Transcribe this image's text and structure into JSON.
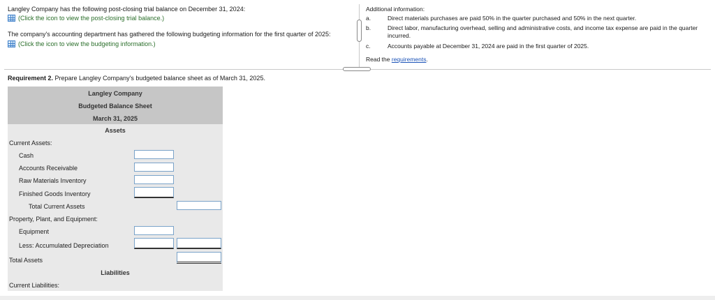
{
  "intro": {
    "trial_balance_text": "Langley Company has the following post-closing trial balance on December 31, 2024:",
    "trial_balance_link": "(Click the icon to view the post-closing trial balance.)",
    "budgeting_text": "The company's accounting department has gathered the following budgeting information for the first quarter of 2025:",
    "budgeting_link": "(Click the icon to view the budgeting information.)"
  },
  "additional": {
    "heading": "Additional information:",
    "items": [
      {
        "letter": "a.",
        "text": "Direct materials purchases are paid 50% in the quarter purchased and 50% in the next quarter."
      },
      {
        "letter": "b.",
        "text": "Direct labor, manufacturing overhead, selling and administrative costs, and income tax expense are paid in the quarter incurred."
      },
      {
        "letter": "c.",
        "text": "Accounts payable at December 31, 2024 are paid in the first quarter of 2025."
      }
    ],
    "read_prefix": "Read the",
    "read_link": "requirements",
    "read_suffix": "."
  },
  "requirement": {
    "bold": "Requirement 2.",
    "text": " Prepare Langley Company's budgeted balance sheet as of March 31, 2025."
  },
  "balance_sheet": {
    "company": "Langley Company",
    "title": "Budgeted Balance Sheet",
    "date": "March 31, 2025",
    "assets_heading": "Assets",
    "current_assets_label": "Current Assets:",
    "cash": "Cash",
    "accounts_receivable": "Accounts Receivable",
    "raw_materials": "Raw Materials Inventory",
    "finished_goods": "Finished Goods Inventory",
    "total_current_assets": "Total Current Assets",
    "ppe_label": "Property, Plant, and Equipment:",
    "equipment": "Equipment",
    "accum_depr": "Less: Accumulated Depreciation",
    "total_assets": "Total Assets",
    "liabilities_heading": "Liabilities",
    "current_liabilities_label": "Current Liabilities:"
  }
}
